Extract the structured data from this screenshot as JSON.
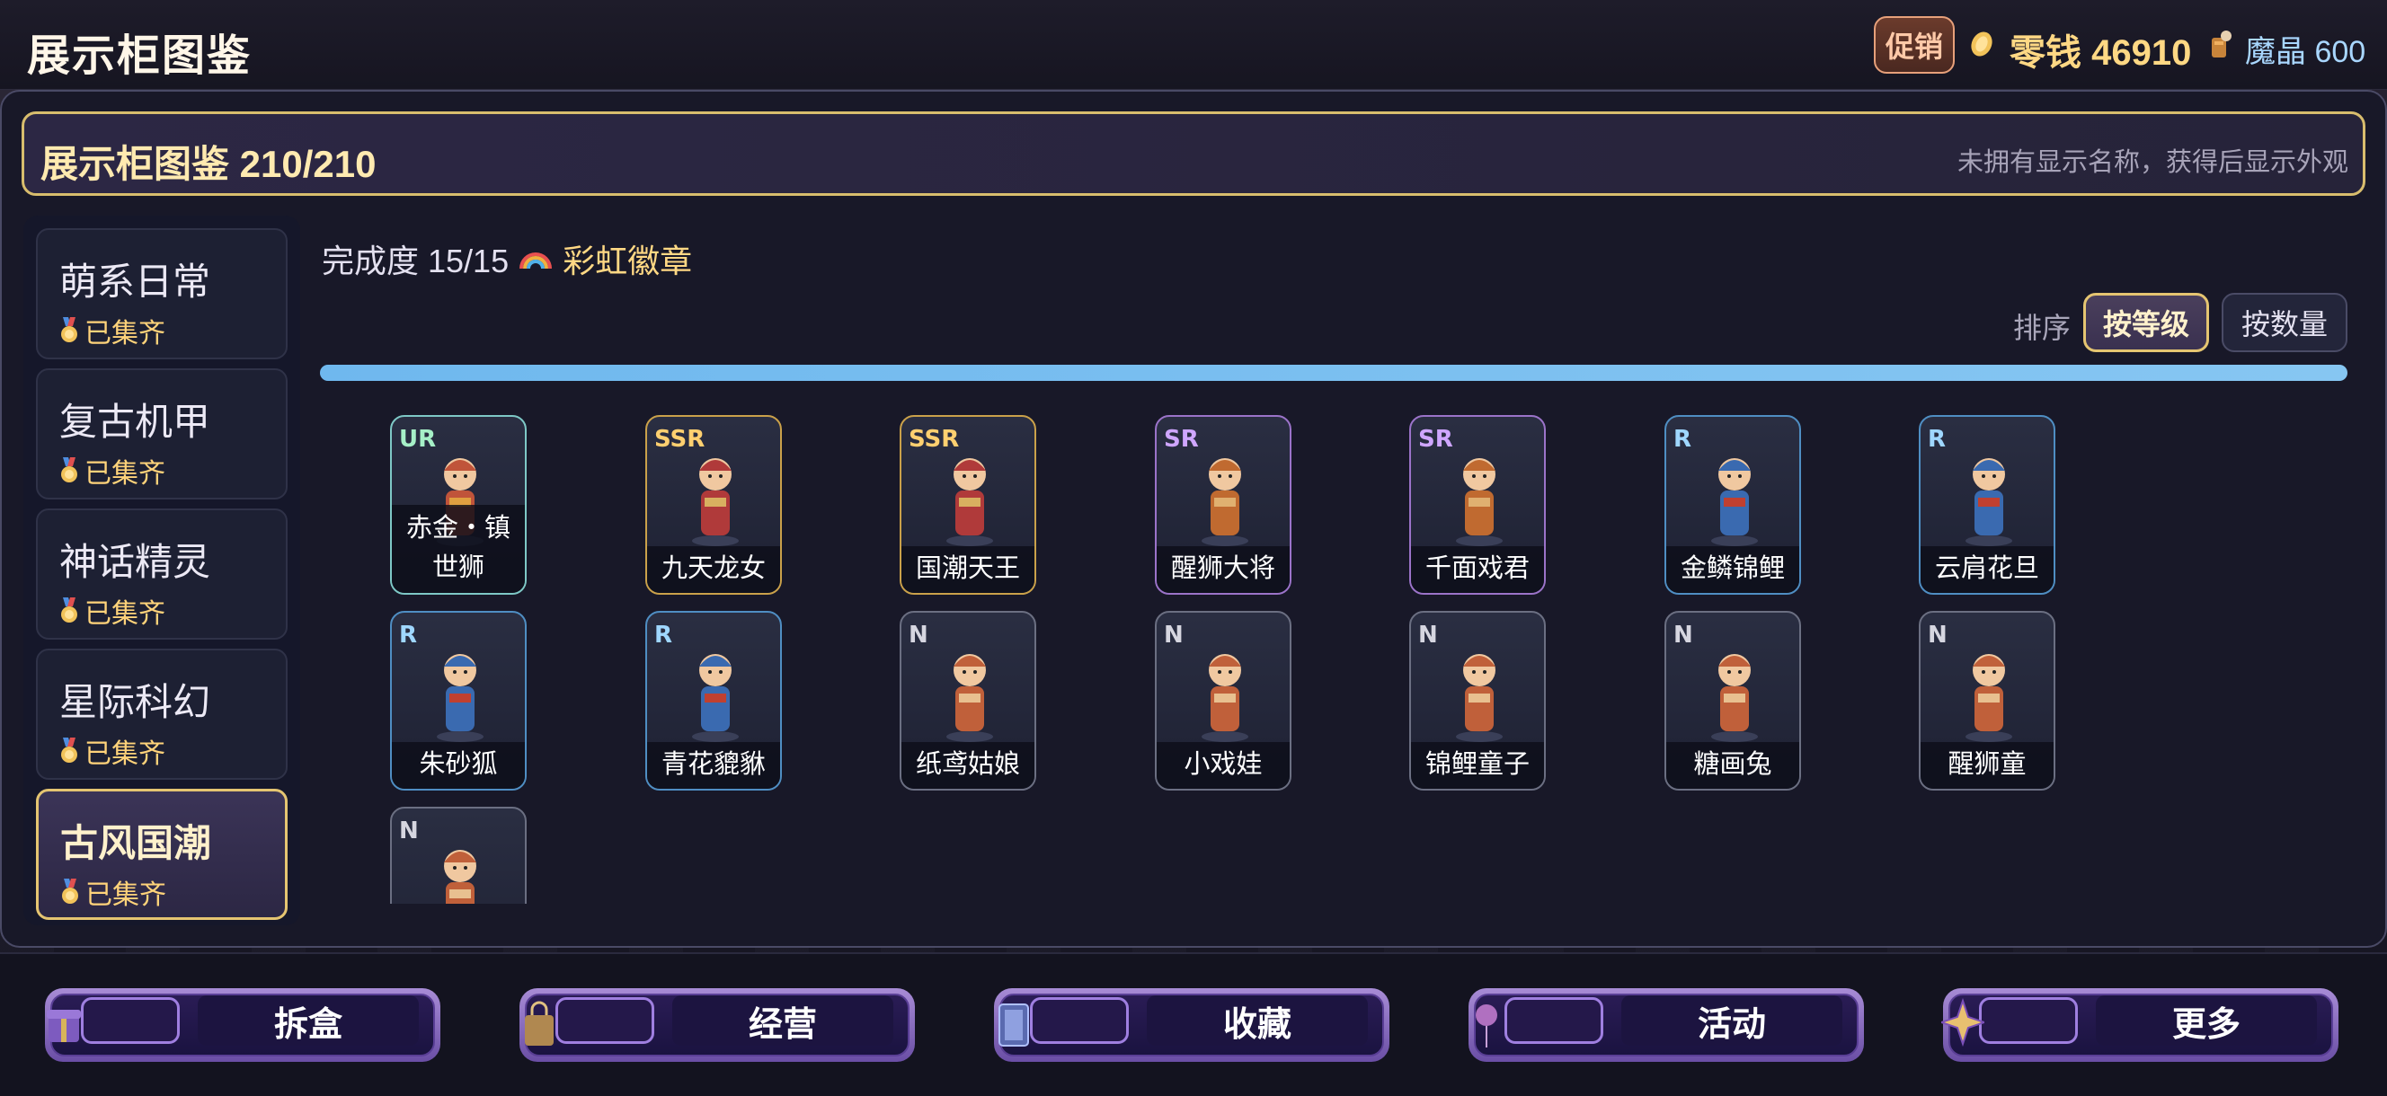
{
  "app": {
    "title": "展示柜图鉴"
  },
  "topbar": {
    "promo_label": "促销",
    "coins_label": "零钱 46910",
    "gems_label": "魔晶 600"
  },
  "header": {
    "title": "展示柜图鉴 210/210",
    "hint": "未拥有显示名称，获得后显示外观"
  },
  "sidebar": {
    "items": [
      {
        "label": "萌系日常",
        "status": "已集齐"
      },
      {
        "label": "复古机甲",
        "status": "已集齐"
      },
      {
        "label": "神话精灵",
        "status": "已集齐"
      },
      {
        "label": "星际科幻",
        "status": "已集齐"
      },
      {
        "label": "古风国潮",
        "status": "已集齐"
      }
    ]
  },
  "content": {
    "completion_label": "完成度 15/15",
    "badge_label": "彩虹徽章",
    "sort_label": "排序",
    "sort_level": "按等级",
    "sort_count": "按数量",
    "progress_fraction": 1.0
  },
  "figures": [
    {
      "rarity": "UR",
      "name": "赤金・镇世狮"
    },
    {
      "rarity": "SSR",
      "name": "九天龙女"
    },
    {
      "rarity": "SSR",
      "name": "国潮天王"
    },
    {
      "rarity": "SR",
      "name": "醒狮大将"
    },
    {
      "rarity": "SR",
      "name": "千面戏君"
    },
    {
      "rarity": "R",
      "name": "金鳞锦鲤"
    },
    {
      "rarity": "R",
      "name": "云肩花旦"
    },
    {
      "rarity": "R",
      "name": "朱砂狐"
    },
    {
      "rarity": "R",
      "name": "青花貔貅"
    },
    {
      "rarity": "N",
      "name": "纸鸢姑娘"
    },
    {
      "rarity": "N",
      "name": "小戏娃"
    },
    {
      "rarity": "N",
      "name": "锦鲤童子"
    },
    {
      "rarity": "N",
      "name": "糖画兔"
    },
    {
      "rarity": "N",
      "name": "醒狮童"
    },
    {
      "rarity": "N",
      "name": ""
    }
  ],
  "bottom_nav": [
    {
      "label": "拆盒",
      "icon": "gift-box-icon"
    },
    {
      "label": "经营",
      "icon": "shop-bag-icon"
    },
    {
      "label": "收藏",
      "icon": "display-case-icon"
    },
    {
      "label": "活动",
      "icon": "balloon-icon"
    },
    {
      "label": "更多",
      "icon": "star-icon"
    }
  ],
  "colors": {
    "accent_gold": "#e5c571",
    "progress": "#7cc1f0",
    "coin": "#ffd884",
    "gem": "#a9d7ff"
  }
}
